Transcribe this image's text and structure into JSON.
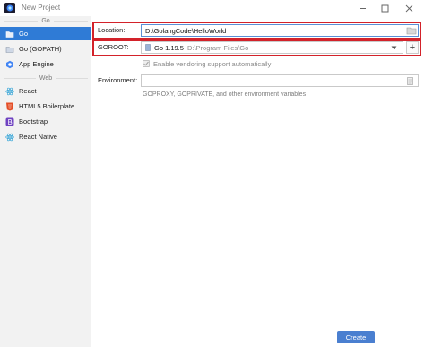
{
  "window": {
    "title": "New Project"
  },
  "sidebar": {
    "groups": [
      {
        "header": "Go",
        "items": [
          {
            "label": "Go",
            "selected": true,
            "icon": "folder-icon"
          },
          {
            "label": "Go (GOPATH)",
            "selected": false,
            "icon": "folder-icon"
          },
          {
            "label": "App Engine",
            "selected": false,
            "icon": "app-engine-icon"
          }
        ]
      },
      {
        "header": "Web",
        "items": [
          {
            "label": "React",
            "selected": false,
            "icon": "react-icon"
          },
          {
            "label": "HTML5 Boilerplate",
            "selected": false,
            "icon": "html5-icon"
          },
          {
            "label": "Bootstrap",
            "selected": false,
            "icon": "bootstrap-icon"
          },
          {
            "label": "React Native",
            "selected": false,
            "icon": "react-icon"
          }
        ]
      }
    ]
  },
  "form": {
    "location": {
      "label": "Location:",
      "value": "D:\\GolangCode\\HelloWorld"
    },
    "goroot": {
      "label": "GOROOT:",
      "version": "Go 1.19.5",
      "path": "D:\\Program Files\\Go"
    },
    "vendoring": {
      "label": "Enable vendoring support automatically",
      "checked": true,
      "disabled": true
    },
    "environment": {
      "label": "Environment:",
      "value": "",
      "hint": "GOPROXY, GOPRIVATE, and other environment variables"
    }
  },
  "footer": {
    "create_label": "Create"
  },
  "colors": {
    "accent": "#2f7bd6",
    "highlight": "#d3222a",
    "button": "#4a7fd0"
  }
}
